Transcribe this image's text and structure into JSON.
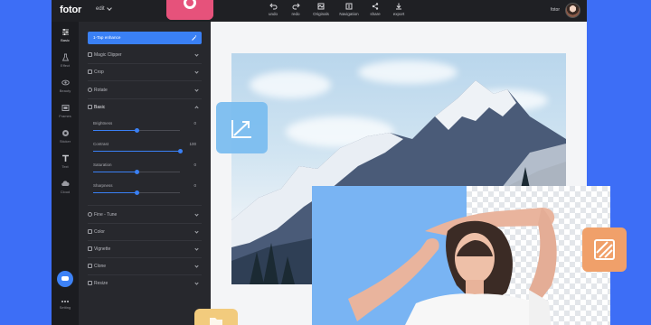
{
  "app": {
    "logo": "fotor",
    "edit_menu": "edit",
    "user_name": "fotor"
  },
  "toolbar": [
    {
      "label": "undo",
      "icon": "undo-icon"
    },
    {
      "label": "redo",
      "icon": "redo-icon"
    },
    {
      "label": "Originals",
      "icon": "compare-icon"
    },
    {
      "label": "Navigation",
      "icon": "history-icon"
    },
    {
      "label": "share",
      "icon": "share-icon"
    },
    {
      "label": "export",
      "icon": "download-icon"
    }
  ],
  "rail": [
    {
      "label": "Basic",
      "icon": "sliders-icon",
      "active": true
    },
    {
      "label": "Effect",
      "icon": "flask-icon"
    },
    {
      "label": "Beauty",
      "icon": "eye-icon"
    },
    {
      "label": "Frames",
      "icon": "frame-icon"
    },
    {
      "label": "Sticker",
      "icon": "sticker-icon"
    },
    {
      "label": "Text",
      "icon": "text-icon"
    },
    {
      "label": "Cloud",
      "icon": "cloud-icon"
    },
    {
      "label": "Setting",
      "icon": "more-icon"
    }
  ],
  "panel": {
    "edit_button": "1-Tap enhance",
    "sections_top": [
      {
        "label": "Magic Clipper",
        "icon": "scissors-icon"
      },
      {
        "label": "Crop",
        "icon": "crop-icon"
      },
      {
        "label": "Rotate",
        "icon": "rotate-icon"
      },
      {
        "label": "Basic",
        "icon": "adjust-icon",
        "open": true
      }
    ],
    "sliders": [
      {
        "name": "Brightness",
        "value": "0",
        "fraction": 0.5
      },
      {
        "name": "Contrast",
        "value": "100",
        "fraction": 1.0
      },
      {
        "name": "Saturation",
        "value": "0",
        "fraction": 0.5
      },
      {
        "name": "Sharpness",
        "value": "0",
        "fraction": 0.5
      }
    ],
    "sections_bottom": [
      {
        "label": "Fine - Tune",
        "icon": "tune-icon"
      },
      {
        "label": "Color",
        "icon": "color-icon"
      },
      {
        "label": "Vignette",
        "icon": "vignette-icon"
      },
      {
        "label": "Clone",
        "icon": "clone-icon"
      },
      {
        "label": "Resize",
        "icon": "resize-icon"
      }
    ]
  },
  "colors": {
    "accent": "#3a80f5",
    "background": "#3d6ef6",
    "badge_pink": "#e6527b",
    "tile_orange": "#f0a06a",
    "tile_yellow": "#f2cb7d",
    "tile_blue": "#7cbef0",
    "cutout_blue": "#79b4f3"
  }
}
